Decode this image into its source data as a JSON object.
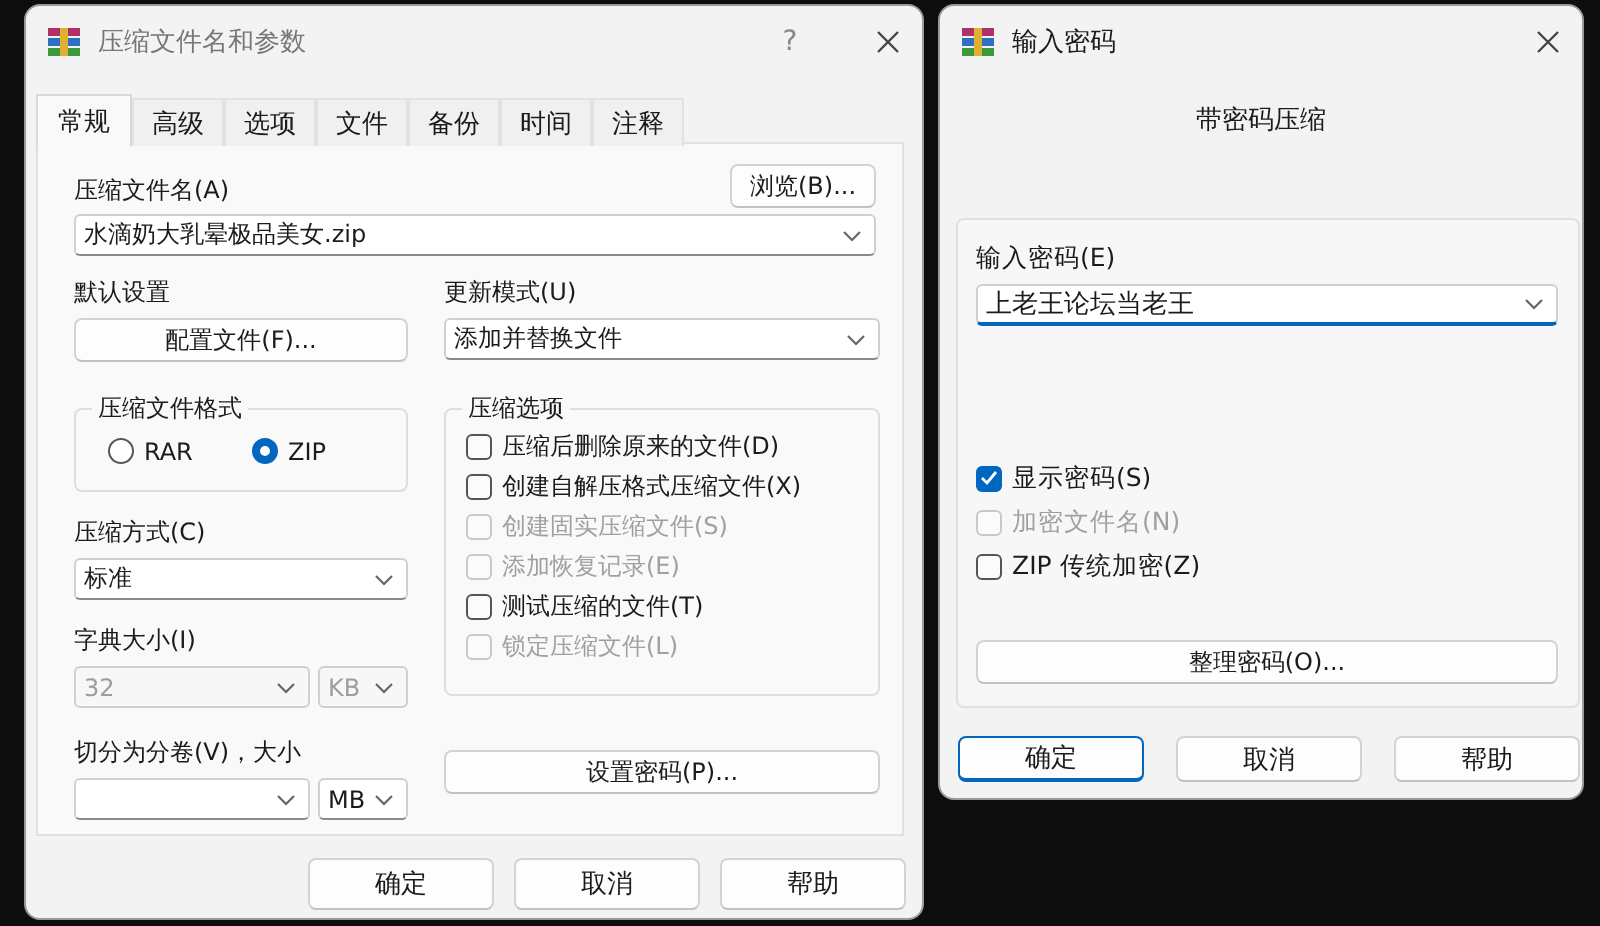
{
  "compress_dialog": {
    "title": "压缩文件名和参数",
    "help_glyph": "?",
    "tabs": [
      {
        "label": "常规",
        "selected": true
      },
      {
        "label": "高级",
        "selected": false
      },
      {
        "label": "选项",
        "selected": false
      },
      {
        "label": "文件",
        "selected": false
      },
      {
        "label": "备份",
        "selected": false
      },
      {
        "label": "时间",
        "selected": false
      },
      {
        "label": "注释",
        "selected": false
      }
    ],
    "archive_name": {
      "label": "压缩文件名(A)",
      "value": "水滴奶大乳晕极品美女.zip"
    },
    "browse_button": "浏览(B)...",
    "profile": {
      "label": "默认设置",
      "button": "配置文件(F)..."
    },
    "update_mode": {
      "label": "更新模式(U)",
      "value": "添加并替换文件"
    },
    "archive_format": {
      "label": "压缩文件格式",
      "options": [
        {
          "label": "RAR",
          "selected": false
        },
        {
          "label": "ZIP",
          "selected": true
        }
      ]
    },
    "compression_options": {
      "label": "压缩选项",
      "items": [
        {
          "label": "压缩后删除原来的文件(D)",
          "checked": false,
          "disabled": false
        },
        {
          "label": "创建自解压格式压缩文件(X)",
          "checked": false,
          "disabled": false
        },
        {
          "label": "创建固实压缩文件(S)",
          "checked": false,
          "disabled": true
        },
        {
          "label": "添加恢复记录(E)",
          "checked": false,
          "disabled": true
        },
        {
          "label": "测试压缩的文件(T)",
          "checked": false,
          "disabled": false
        },
        {
          "label": "锁定压缩文件(L)",
          "checked": false,
          "disabled": true
        }
      ]
    },
    "compression_method": {
      "label": "压缩方式(C)",
      "value": "标准"
    },
    "dictionary_size": {
      "label": "字典大小(I)",
      "value": "32",
      "unit": "KB",
      "disabled": true
    },
    "split_volumes": {
      "label": "切分为分卷(V)，大小",
      "unit": "MB"
    },
    "set_password_button": "设置密码(P)...",
    "buttons": [
      {
        "label": "确定"
      },
      {
        "label": "取消"
      },
      {
        "label": "帮助"
      }
    ]
  },
  "password_dialog": {
    "title": "输入密码",
    "heading": "带密码压缩",
    "password": {
      "label": "输入密码(E)",
      "value": "上老王论坛当老王"
    },
    "options": [
      {
        "label": "显示密码(S)",
        "checked": true,
        "disabled": false
      },
      {
        "label": "加密文件名(N)",
        "checked": false,
        "disabled": true
      },
      {
        "label": "ZIP 传统加密(Z)",
        "checked": false,
        "disabled": false
      }
    ],
    "organize_button": "整理密码(O)...",
    "buttons": [
      {
        "label": "确定",
        "default": true
      },
      {
        "label": "取消",
        "default": false
      },
      {
        "label": "帮助",
        "default": false
      }
    ]
  }
}
